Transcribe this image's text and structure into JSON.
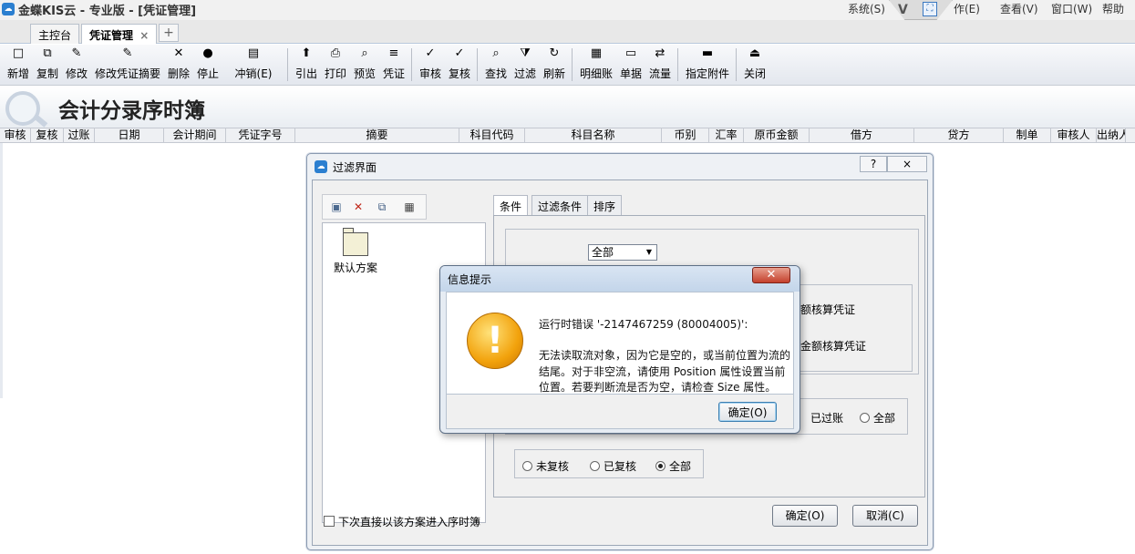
{
  "app": {
    "title": "金蝶KIS云 - 专业版 - [凭证管理]",
    "logo": "cloud-logo-icon",
    "menus": [
      "系统(S)",
      "作(E)",
      "查看(V)",
      "窗口(W)",
      "帮助"
    ]
  },
  "tabs": {
    "home": "主控台",
    "voucher": "凭证管理",
    "voucher_close": "×",
    "add": "+"
  },
  "toolbar": {
    "groups": [
      [
        {
          "label": "新增",
          "icon": "new-doc-icon",
          "glyph": "□"
        },
        {
          "label": "复制",
          "icon": "copy-icon",
          "glyph": "⧉"
        },
        {
          "label": "修改",
          "icon": "edit-icon",
          "glyph": "✎"
        },
        {
          "label": "修改凭证摘要",
          "icon": "edit-summary-icon",
          "glyph": "✎"
        },
        {
          "label": "删除",
          "icon": "delete-icon",
          "glyph": "✕"
        },
        {
          "label": "停止",
          "icon": "stop-icon",
          "glyph": "●"
        },
        {
          "label": "冲销(E)",
          "icon": "reverse-icon",
          "glyph": "▤"
        }
      ],
      [
        {
          "label": "引出",
          "icon": "export-icon",
          "glyph": "⬆"
        },
        {
          "label": "打印",
          "icon": "print-icon",
          "glyph": "⎙"
        },
        {
          "label": "预览",
          "icon": "preview-icon",
          "glyph": "⌕"
        },
        {
          "label": "凭证",
          "icon": "voucher-icon",
          "glyph": "≡"
        }
      ],
      [
        {
          "label": "审核",
          "icon": "audit-icon",
          "glyph": "✓"
        },
        {
          "label": "复核",
          "icon": "recheck-icon",
          "glyph": "✓"
        }
      ],
      [
        {
          "label": "查找",
          "icon": "find-icon",
          "glyph": "⌕"
        },
        {
          "label": "过滤",
          "icon": "filter-icon",
          "glyph": "⧩"
        },
        {
          "label": "刷新",
          "icon": "refresh-icon",
          "glyph": "↻"
        }
      ],
      [
        {
          "label": "明细账",
          "icon": "ledger-icon",
          "glyph": "▦"
        },
        {
          "label": "单据",
          "icon": "document-icon",
          "glyph": "▭"
        },
        {
          "label": "流量",
          "icon": "flow-icon",
          "glyph": "⇄"
        }
      ],
      [
        {
          "label": "指定附件",
          "icon": "attachment-folder-icon",
          "glyph": "▬"
        }
      ],
      [
        {
          "label": "关闭",
          "icon": "exit-icon",
          "glyph": "⏏"
        }
      ]
    ]
  },
  "page": {
    "title": "会计分录序时簿",
    "columns": [
      "审核",
      "复核",
      "过账",
      "日期",
      "会计期间",
      "凭证字号",
      "摘要",
      "科目代码",
      "科目名称",
      "币别",
      "汇率",
      "原币金额",
      "借方",
      "贷方",
      "制单",
      "审核人",
      "出纳人"
    ]
  },
  "filter_dialog": {
    "title": "过滤界面",
    "help": "?",
    "close": "×",
    "mini_toolbar": [
      "save-icon",
      "delete-icon",
      "copy-scheme-icon",
      "grid-icon"
    ],
    "scheme": "默认方案",
    "tabs": [
      "条件",
      "过滤条件",
      "排序"
    ],
    "combo_value": "全部",
    "amount_options": [
      "里金额核算凭证",
      "数里金额核算凭证"
    ],
    "posting_options": [
      "已过账",
      "全部"
    ],
    "recheck_options": [
      {
        "label": "未复核",
        "checked": false
      },
      {
        "label": "已复核",
        "checked": false
      },
      {
        "label": "全部",
        "checked": true
      }
    ],
    "checkbox_label": "下次直接以该方案进入序时簿",
    "ok": "确定(O)",
    "cancel": "取消(C)"
  },
  "message_box": {
    "title": "信息提示",
    "close": "✕",
    "icon": "warning-icon",
    "line1": "运行时错误 '-2147467259 (80004005)':",
    "line2": "无法读取流对象，因为它是空的，或当前位置为流的",
    "line3": "结尾。对于非空流，请使用 Position 属性设置当前",
    "line4": "位置。若要判断流是否为空，请检查 Size 属性。",
    "ok": "确定(O)"
  }
}
